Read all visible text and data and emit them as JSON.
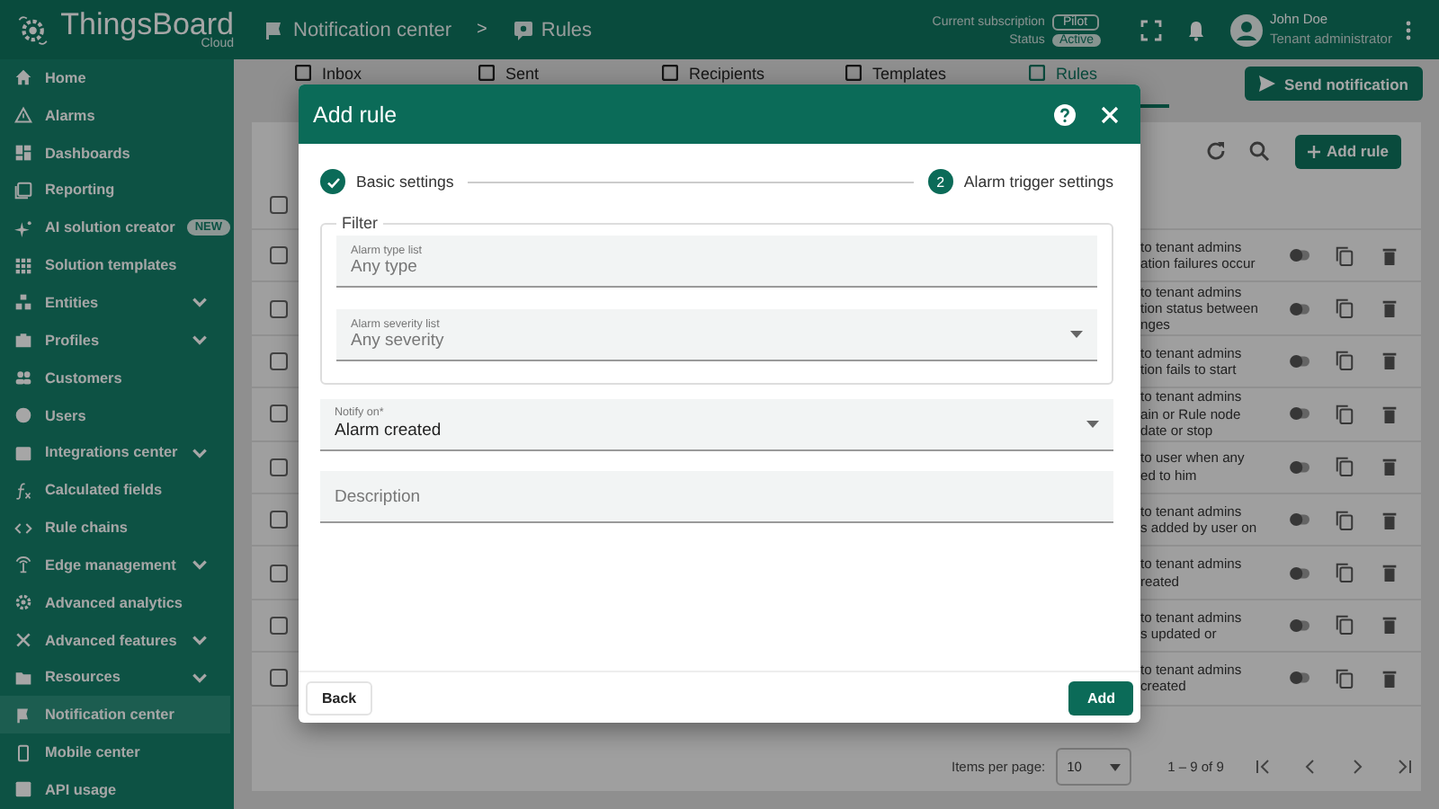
{
  "header": {
    "logo": {
      "name": "ThingsBoard",
      "edition": "Cloud"
    },
    "breadcrumb": [
      "Notification center",
      "Rules"
    ],
    "separator": ">",
    "subscription": {
      "label": "Current subscription",
      "plan": "Pilot",
      "status_label": "Status",
      "status": "Active"
    },
    "user": {
      "name": "John Doe",
      "role": "Tenant administrator"
    }
  },
  "sidebar": {
    "items": [
      {
        "label": "Home",
        "selected": false,
        "expandable": false
      },
      {
        "label": "Alarms",
        "selected": false,
        "expandable": false
      },
      {
        "label": "Dashboards",
        "selected": false,
        "expandable": false
      },
      {
        "label": "Reporting",
        "selected": false,
        "expandable": false
      },
      {
        "label": "AI solution creator",
        "selected": false,
        "expandable": false,
        "badge": "NEW"
      },
      {
        "label": "Solution templates",
        "selected": false,
        "expandable": false
      },
      {
        "label": "Entities",
        "selected": false,
        "expandable": true
      },
      {
        "label": "Profiles",
        "selected": false,
        "expandable": true
      },
      {
        "label": "Customers",
        "selected": false,
        "expandable": false
      },
      {
        "label": "Users",
        "selected": false,
        "expandable": false
      },
      {
        "label": "Integrations center",
        "selected": false,
        "expandable": true
      },
      {
        "label": "Calculated fields",
        "selected": false,
        "expandable": false
      },
      {
        "label": "Rule chains",
        "selected": false,
        "expandable": false
      },
      {
        "label": "Edge management",
        "selected": false,
        "expandable": true
      },
      {
        "label": "Advanced analytics",
        "selected": false,
        "expandable": false
      },
      {
        "label": "Advanced features",
        "selected": false,
        "expandable": true
      },
      {
        "label": "Resources",
        "selected": false,
        "expandable": true
      },
      {
        "label": "Notification center",
        "selected": true,
        "expandable": false
      },
      {
        "label": "Mobile center",
        "selected": false,
        "expandable": false
      },
      {
        "label": "API usage",
        "selected": false,
        "expandable": false
      }
    ]
  },
  "tabs": [
    {
      "label": "Inbox",
      "selected": false
    },
    {
      "label": "Sent",
      "selected": false
    },
    {
      "label": "Recipients",
      "selected": false
    },
    {
      "label": "Templates",
      "selected": false
    },
    {
      "label": "Rules",
      "selected": true
    }
  ],
  "send_button": "Send notification",
  "add_button": "Add rule",
  "table": {
    "header_checked": false,
    "rows": [
      {
        "checked": false,
        "description": "to tenant admins\nation failures occur",
        "enabled": false
      },
      {
        "checked": false,
        "description": "to tenant admins\ntion status between\nnges",
        "enabled": false
      },
      {
        "checked": false,
        "description": "to tenant admins\ntion fails to start",
        "enabled": false
      },
      {
        "checked": false,
        "description": "to tenant admins\nain or Rule node\ndate or stop",
        "enabled": false
      },
      {
        "checked": false,
        "description": "to user when any\ned to him",
        "enabled": false
      },
      {
        "checked": false,
        "description": "to tenant admins\ns added by user on",
        "enabled": false
      },
      {
        "checked": false,
        "description": "to tenant admins\nreated",
        "enabled": false
      },
      {
        "checked": false,
        "description": "to tenant admins\ns updated or",
        "enabled": false
      },
      {
        "checked": false,
        "description": "to tenant admins\ncreated",
        "enabled": false
      }
    ]
  },
  "paginator": {
    "label": "Items per page:",
    "page_size": "10",
    "range": "1 – 9 of 9"
  },
  "dialog": {
    "title": "Add rule",
    "steps": [
      {
        "label": "Basic settings",
        "completed": true
      },
      {
        "label": "Alarm trigger settings",
        "number": "2",
        "completed": false
      }
    ],
    "filter": {
      "legend": "Filter",
      "fields": [
        {
          "label": "Alarm type list",
          "placeholder": "Any type",
          "kind": "chips"
        },
        {
          "label": "Alarm severity list",
          "placeholder": "Any severity",
          "kind": "select"
        }
      ]
    },
    "notify_on": {
      "label": "Notify on*",
      "value": "Alarm created",
      "kind": "select"
    },
    "description": {
      "placeholder": "Description"
    },
    "back_button": "Back",
    "add_button": "Add"
  }
}
